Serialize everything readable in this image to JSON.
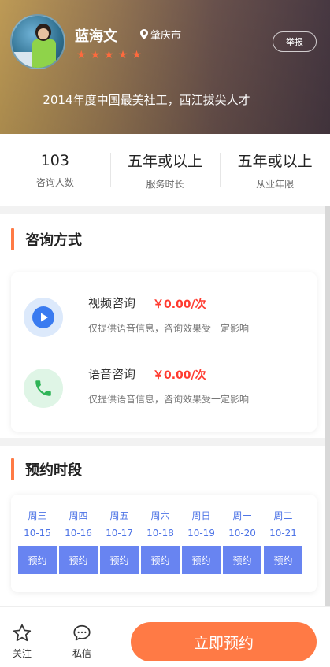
{
  "profile": {
    "name": "蓝海文",
    "location": "肇庆市",
    "report_label": "举报",
    "rating": 5,
    "tagline": "2014年度中国最美社工，西江拔尖人才"
  },
  "stats": [
    {
      "value": "103",
      "label": "咨询人数"
    },
    {
      "value": "五年或以上",
      "label": "服务时长"
    },
    {
      "value": "五年或以上",
      "label": "从业年限"
    }
  ],
  "consult": {
    "title": "咨询方式",
    "methods": [
      {
        "name": "视频咨询",
        "price": "￥0.00/次",
        "desc": "仅提供语音信息，咨询效果受一定影响",
        "icon": "video-icon"
      },
      {
        "name": "语音咨询",
        "price": "￥0.00/次",
        "desc": "仅提供语音信息，咨询效果受一定影响",
        "icon": "phone-icon"
      }
    ]
  },
  "schedule": {
    "title": "预约时段",
    "days": [
      {
        "week": "周三",
        "date": "10-15",
        "button": "预约"
      },
      {
        "week": "周四",
        "date": "10-16",
        "button": "预约"
      },
      {
        "week": "周五",
        "date": "10-17",
        "button": "预约"
      },
      {
        "week": "周六",
        "date": "10-18",
        "button": "预约"
      },
      {
        "week": "周日",
        "date": "10-19",
        "button": "预约"
      },
      {
        "week": "周一",
        "date": "10-20",
        "button": "预约"
      },
      {
        "week": "周二",
        "date": "10-21",
        "button": "预约"
      }
    ]
  },
  "bottom_bar": {
    "follow_label": "关注",
    "message_label": "私信",
    "book_now_label": "立即预约"
  },
  "colors": {
    "accent": "#ff7a45",
    "price": "#ff3b30",
    "schedule_blue": "#6884f1",
    "schedule_text": "#4e74e6"
  }
}
